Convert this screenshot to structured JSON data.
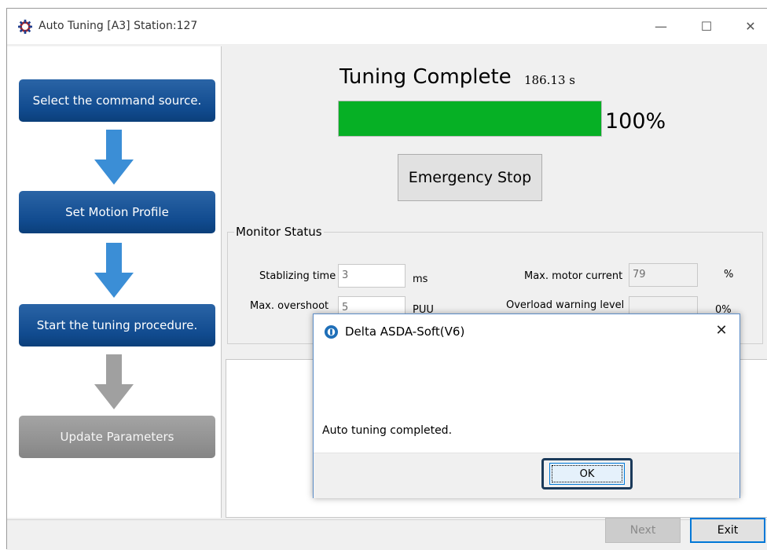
{
  "window": {
    "title": "Auto Tuning [A3] Station:127",
    "minimize": "—",
    "maximize": "☐",
    "close": "✕"
  },
  "steps": [
    {
      "label": "Select the command source.",
      "state": "active"
    },
    {
      "label": "Set Motion Profile",
      "state": "active"
    },
    {
      "label": "Start the tuning procedure.",
      "state": "active"
    },
    {
      "label": "Update Parameters",
      "state": "disabled"
    }
  ],
  "tuning": {
    "status": "Tuning Complete",
    "elapsed": "186.13 s",
    "progress_value": 1.0,
    "progress_label": "100%",
    "emergency_stop": "Emergency Stop",
    "progress_color": "#06b025"
  },
  "monitor": {
    "legend": "Monitor Status",
    "stabilizing_label": "Stablizing time",
    "stabilizing_value": "3",
    "stabilizing_unit": "ms",
    "overshoot_label": "Max. overshoot",
    "overshoot_value": "5",
    "overshoot_unit": "PUU",
    "motor_current_label": "Max. motor current",
    "motor_current_value": "79",
    "motor_current_unit": "%",
    "overload_label": "Overload warning level",
    "overload_value": "",
    "overload_unit": "0%"
  },
  "footer": {
    "next": "Next",
    "exit": "Exit"
  },
  "dialog": {
    "title": "Delta ASDA-Soft(V6)",
    "close": "✕",
    "message": "Auto tuning completed.",
    "ok": "OK"
  },
  "colors": {
    "step_active": "#114b8f",
    "step_disabled": "#8f8f8f",
    "arrow_active": "#3b8ed6",
    "arrow_disabled": "#a0a0a0",
    "highlight_border": "#1b3a5a"
  }
}
